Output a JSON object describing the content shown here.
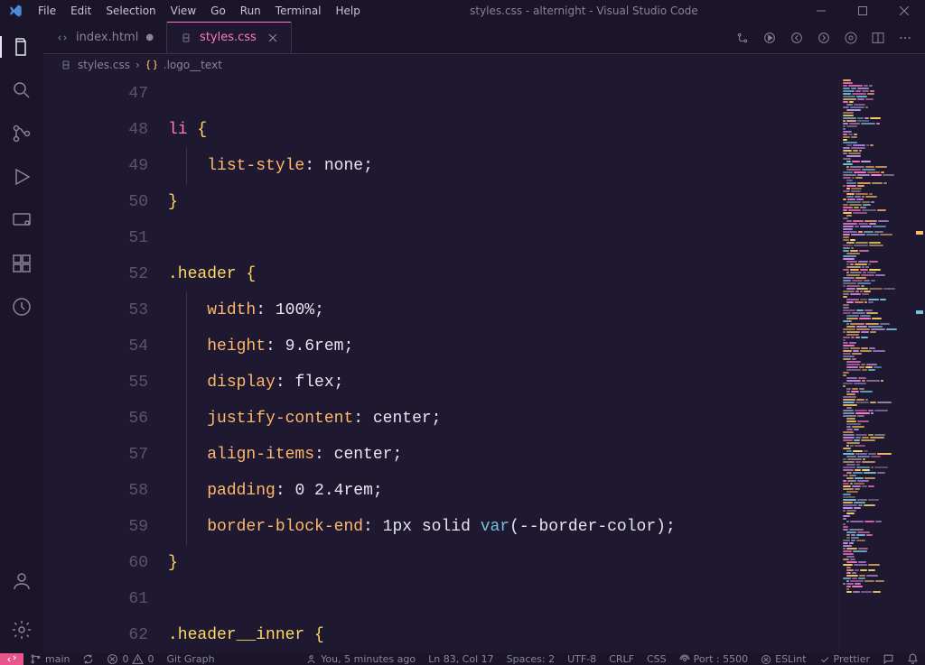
{
  "window": {
    "title": "styles.css - alternight - Visual Studio Code"
  },
  "menu": [
    "File",
    "Edit",
    "Selection",
    "View",
    "Go",
    "Run",
    "Terminal",
    "Help"
  ],
  "tabs": [
    {
      "name": "index.html",
      "active": false,
      "dirty": true
    },
    {
      "name": "styles.css",
      "active": true,
      "dirty": false
    }
  ],
  "breadcrumbs": {
    "file": "styles.css",
    "symbol": ".logo__text"
  },
  "code": {
    "lines": [
      {
        "n": "47",
        "segs": []
      },
      {
        "n": "48",
        "segs": [
          {
            "t": "li ",
            "c": "tok-sel"
          },
          {
            "t": "{",
            "c": "tok-brace"
          }
        ]
      },
      {
        "n": "49",
        "indent": 1,
        "segs": [
          {
            "t": "    "
          },
          {
            "t": "list-style",
            "c": "tok-prop"
          },
          {
            "t": ": ",
            "c": "tok-punc"
          },
          {
            "t": "none",
            "c": "tok-val"
          },
          {
            "t": ";",
            "c": "tok-punc"
          }
        ]
      },
      {
        "n": "50",
        "segs": [
          {
            "t": "}",
            "c": "tok-brace"
          }
        ]
      },
      {
        "n": "51",
        "segs": []
      },
      {
        "n": "52",
        "segs": [
          {
            "t": ".header ",
            "c": "tok-class"
          },
          {
            "t": "{",
            "c": "tok-brace"
          }
        ]
      },
      {
        "n": "53",
        "indent": 1,
        "segs": [
          {
            "t": "    "
          },
          {
            "t": "width",
            "c": "tok-prop"
          },
          {
            "t": ": ",
            "c": "tok-punc"
          },
          {
            "t": "100%",
            "c": "tok-val"
          },
          {
            "t": ";",
            "c": "tok-punc"
          }
        ]
      },
      {
        "n": "54",
        "indent": 1,
        "segs": [
          {
            "t": "    "
          },
          {
            "t": "height",
            "c": "tok-prop"
          },
          {
            "t": ": ",
            "c": "tok-punc"
          },
          {
            "t": "9.6rem",
            "c": "tok-val"
          },
          {
            "t": ";",
            "c": "tok-punc"
          }
        ]
      },
      {
        "n": "55",
        "indent": 1,
        "segs": [
          {
            "t": "    "
          },
          {
            "t": "display",
            "c": "tok-prop"
          },
          {
            "t": ": ",
            "c": "tok-punc"
          },
          {
            "t": "flex",
            "c": "tok-val"
          },
          {
            "t": ";",
            "c": "tok-punc"
          }
        ]
      },
      {
        "n": "56",
        "indent": 1,
        "segs": [
          {
            "t": "    "
          },
          {
            "t": "justify-content",
            "c": "tok-prop"
          },
          {
            "t": ": ",
            "c": "tok-punc"
          },
          {
            "t": "center",
            "c": "tok-val"
          },
          {
            "t": ";",
            "c": "tok-punc"
          }
        ]
      },
      {
        "n": "57",
        "indent": 1,
        "segs": [
          {
            "t": "    "
          },
          {
            "t": "align-items",
            "c": "tok-prop"
          },
          {
            "t": ": ",
            "c": "tok-punc"
          },
          {
            "t": "center",
            "c": "tok-val"
          },
          {
            "t": ";",
            "c": "tok-punc"
          }
        ]
      },
      {
        "n": "58",
        "indent": 1,
        "segs": [
          {
            "t": "    "
          },
          {
            "t": "padding",
            "c": "tok-prop"
          },
          {
            "t": ": ",
            "c": "tok-punc"
          },
          {
            "t": "0 2.4rem",
            "c": "tok-val"
          },
          {
            "t": ";",
            "c": "tok-punc"
          }
        ]
      },
      {
        "n": "59",
        "indent": 1,
        "segs": [
          {
            "t": "    "
          },
          {
            "t": "border-block-end",
            "c": "tok-prop"
          },
          {
            "t": ": ",
            "c": "tok-punc"
          },
          {
            "t": "1px solid ",
            "c": "tok-val"
          },
          {
            "t": "var",
            "c": "tok-func"
          },
          {
            "t": "(",
            "c": "tok-punc"
          },
          {
            "t": "--border-color",
            "c": "tok-val"
          },
          {
            "t": ")",
            "c": "tok-punc"
          },
          {
            "t": ";",
            "c": "tok-punc"
          }
        ]
      },
      {
        "n": "60",
        "segs": [
          {
            "t": "}",
            "c": "tok-brace"
          }
        ]
      },
      {
        "n": "61",
        "segs": []
      },
      {
        "n": "62",
        "segs": [
          {
            "t": ".header__inner ",
            "c": "tok-class"
          },
          {
            "t": "{",
            "c": "tok-brace"
          }
        ]
      }
    ]
  },
  "status": {
    "branch": "main",
    "errors": "0",
    "warnings": "0",
    "gitgraph": "Git Graph",
    "blame": "You, 5 minutes ago",
    "pos": "Ln 83, Col 17",
    "spaces": "Spaces: 2",
    "encoding": "UTF-8",
    "eol": "CRLF",
    "lang": "CSS",
    "port": "Port : 5500",
    "eslint": "ESLint",
    "prettier": "Prettier"
  }
}
